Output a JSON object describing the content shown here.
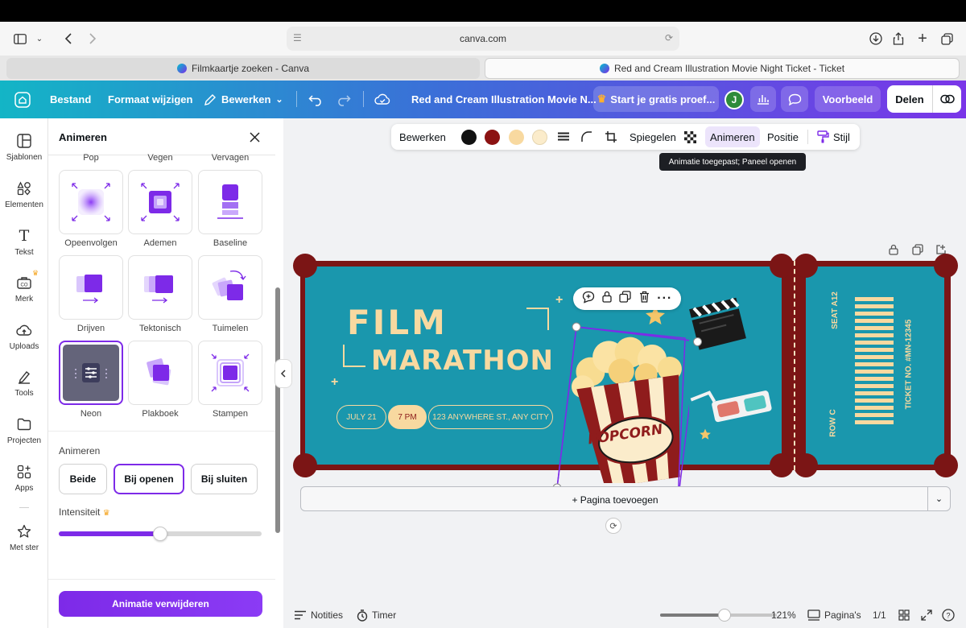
{
  "browser": {
    "address": "canva.com",
    "tabs": [
      {
        "label": "Filmkaartje zoeken - Canva"
      },
      {
        "label": "Red and Cream Illustration Movie Night Ticket - Ticket"
      }
    ]
  },
  "header": {
    "file": "Bestand",
    "resize": "Formaat wijzigen",
    "edit": "Bewerken",
    "doc_title": "Red and Cream Illustration Movie N...",
    "trial": "Start je gratis proef...",
    "avatar_initial": "J",
    "preview": "Voorbeeld",
    "share": "Delen",
    "gradient_start": "#13b5c6",
    "gradient_end": "#7a35e8"
  },
  "rail": {
    "items": [
      {
        "label": "Sjablonen",
        "icon": "templates-icon"
      },
      {
        "label": "Elementen",
        "icon": "elements-icon"
      },
      {
        "label": "Tekst",
        "icon": "text-icon"
      },
      {
        "label": "Merk",
        "icon": "brand-icon"
      },
      {
        "label": "Uploads",
        "icon": "upload-icon"
      },
      {
        "label": "Tools",
        "icon": "tools-icon"
      },
      {
        "label": "Projecten",
        "icon": "folder-icon"
      },
      {
        "label": "Apps",
        "icon": "apps-icon"
      },
      {
        "label": "Met ster",
        "icon": "star-icon"
      }
    ]
  },
  "panel": {
    "title": "Animeren",
    "top_labels": [
      "Pop",
      "Vegen",
      "Vervagen"
    ],
    "tiles": [
      {
        "label": "Opeenvolgen"
      },
      {
        "label": "Ademen"
      },
      {
        "label": "Baseline"
      },
      {
        "label": "Drijven"
      },
      {
        "label": "Tektonisch"
      },
      {
        "label": "Tuimelen"
      },
      {
        "label": "Neon"
      },
      {
        "label": "Plakboek"
      },
      {
        "label": "Stampen"
      }
    ],
    "selected_tile": "Neon",
    "animate_label": "Animeren",
    "options": [
      "Beide",
      "Bij openen",
      "Bij sluiten"
    ],
    "selected_option": "Bij openen",
    "intensity_label": "Intensiteit",
    "intensity_value": 0.5,
    "remove_button": "Animatie verwijderen",
    "accent": "#7d2ae8"
  },
  "toolbar": {
    "edit": "Bewerken",
    "colors": [
      "#111111",
      "#8b1212",
      "#f8d9a0",
      "#fbeccb"
    ],
    "flip": "Spiegelen",
    "animate": "Animeren",
    "position": "Positie",
    "style": "Stijl",
    "tooltip": "Animatie toegepast; Paneel openen"
  },
  "ticket": {
    "title_line1": "FILM",
    "title_line2": "MARATHON",
    "date": "JULY 21",
    "time": "7 PM",
    "address": "123 ANYWHERE ST., ANY CITY",
    "popcorn": "POPCORN",
    "seat": "SEAT A12",
    "row": "ROW C",
    "ticket_no": "TICKET NO. #MN-12345",
    "bg": "#1a97ad",
    "frame": "#7b1515",
    "cream": "#f8d9a0"
  },
  "canvas": {
    "add_page": "+ Pagina toevoegen"
  },
  "bottom": {
    "notes": "Notities",
    "timer": "Timer",
    "zoom": "121%",
    "zoom_value": 0.55,
    "pages": "Pagina's",
    "page_count": "1/1"
  }
}
